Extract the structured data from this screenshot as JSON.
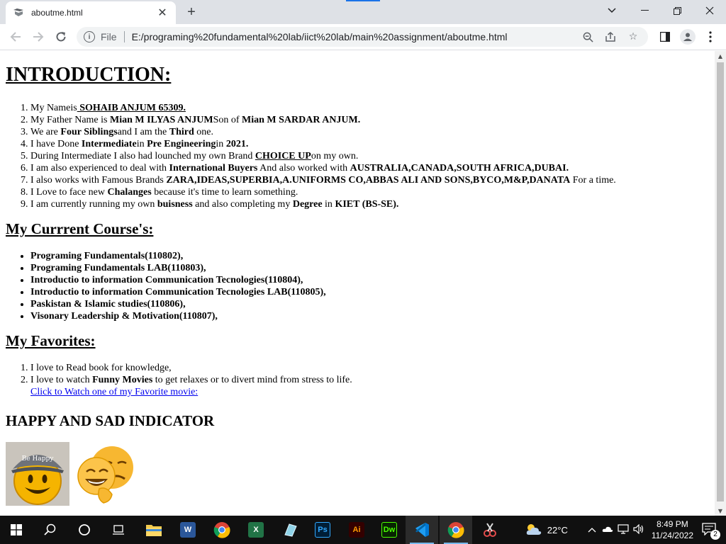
{
  "browser": {
    "tab_title": "aboutme.html",
    "tab_close": "✕",
    "new_tab": "+",
    "scheme_label": "File",
    "url": "E:/programing%20fundamental%20lab/iict%20lab/main%20assignment/aboutme.html"
  },
  "page": {
    "intro_heading": "INTRODUCTION:",
    "intro_items": [
      [
        {
          "t": "My Nameis"
        },
        {
          "t": " SOHAIB ANJUM 65309.",
          "b": true,
          "u": true
        }
      ],
      [
        {
          "t": "My Father Name is "
        },
        {
          "t": "Mian M ILYAS ANJUM",
          "b": true
        },
        {
          "t": "Son of "
        },
        {
          "t": "Mian M SARDAR ANJUM.",
          "b": true
        }
      ],
      [
        {
          "t": "We are "
        },
        {
          "t": "Four Siblings",
          "b": true
        },
        {
          "t": "and I am the "
        },
        {
          "t": "Third",
          "b": true
        },
        {
          "t": " one."
        }
      ],
      [
        {
          "t": "I have Done "
        },
        {
          "t": "Intermediate",
          "b": true
        },
        {
          "t": "in "
        },
        {
          "t": "Pre Engineering",
          "b": true
        },
        {
          "t": "in "
        },
        {
          "t": "2021.",
          "b": true
        }
      ],
      [
        {
          "t": "During Intermediate I also had lounched my own Brand "
        },
        {
          "t": "CHOICE UP",
          "b": true,
          "u": true
        },
        {
          "t": "on my own."
        }
      ],
      [
        {
          "t": "I am also experienced to deal with "
        },
        {
          "t": "International Buyers",
          "b": true
        },
        {
          "t": " And also worked with "
        },
        {
          "t": "AUSTRALIA,CANADA,SOUTH AFRICA,DUBAI.",
          "b": true
        }
      ],
      [
        {
          "t": "I also works with Famous Brands "
        },
        {
          "t": "ZARA,IDEAS,SUPERBIA,A.UNIFORMS CO,ABBAS ALI AND SONS,BYCO,M&P,DANATA",
          "b": true
        },
        {
          "t": " For a time."
        }
      ],
      [
        {
          "t": "I Love to face new "
        },
        {
          "t": "Chalanges",
          "b": true
        },
        {
          "t": " because it's time to learn something."
        }
      ],
      [
        {
          "t": "I am currently running my own "
        },
        {
          "t": "buisness",
          "b": true
        },
        {
          "t": " and also completing my "
        },
        {
          "t": "Degree",
          "b": true
        },
        {
          "t": " in "
        },
        {
          "t": "KIET (BS-SE).",
          "b": true
        }
      ]
    ],
    "courses_heading": "My Currrent Course's:",
    "courses": [
      "Programing Fundamentals(110802),",
      "Programing Fundamentals LAB(110803),",
      "Introductio to information Communication Tecnologies(110804),",
      "Introductio to information Communication Tecnologies LAB(110805),",
      "Paskistan & Islamic studies(110806),",
      "Visonary Leadership & Motivation(110807),"
    ],
    "favorites_heading": "My Favorites:",
    "favorites": [
      [
        {
          "t": "I love to Read book for knowledge,"
        }
      ],
      [
        {
          "t": "I love to watch "
        },
        {
          "t": "Funny Movies",
          "b": true
        },
        {
          "t": " to get relaxes or to divert mind from stress to life."
        }
      ]
    ],
    "favorite_link": "Click to Watch one of my Favorite movie:",
    "indicator_heading": "HAPPY AND SAD INDICATOR",
    "happy_cap_text": "Be Happy"
  },
  "taskbar": {
    "temperature": "22°C",
    "time": "8:49 PM",
    "date": "11/24/2022",
    "notification_count": "2",
    "apps": [
      {
        "name": "File Explorer",
        "icon": "folder-icon",
        "color": "#f2c94c"
      },
      {
        "name": "Word",
        "icon": "word-icon",
        "color": "#2b579a",
        "letter": "W"
      },
      {
        "name": "Chrome",
        "icon": "chrome-icon",
        "color": "#4285f4"
      },
      {
        "name": "Excel",
        "icon": "excel-icon",
        "color": "#217346",
        "letter": "X"
      },
      {
        "name": "Notepad",
        "icon": "notepad-icon",
        "color": "#8fd3e8"
      },
      {
        "name": "Photoshop",
        "icon": "photoshop-icon",
        "color": "#001e36",
        "letter": "Ps"
      },
      {
        "name": "Illustrator",
        "icon": "illustrator-icon",
        "color": "#330000",
        "letter": "Ai"
      },
      {
        "name": "Dreamweaver",
        "icon": "dreamweaver-icon",
        "color": "#072401",
        "letter": "Dw"
      },
      {
        "name": "VS Code",
        "icon": "vscode-icon",
        "color": "#0078d4"
      },
      {
        "name": "Chrome",
        "icon": "chrome-icon",
        "color": "#4285f4"
      },
      {
        "name": "Snipping Tool",
        "icon": "snipping-tool-icon",
        "color": "#e34c4c"
      }
    ]
  },
  "colors": {
    "link": "#0000ee",
    "accent": "#1a73e8",
    "taskbar": "#101010"
  }
}
